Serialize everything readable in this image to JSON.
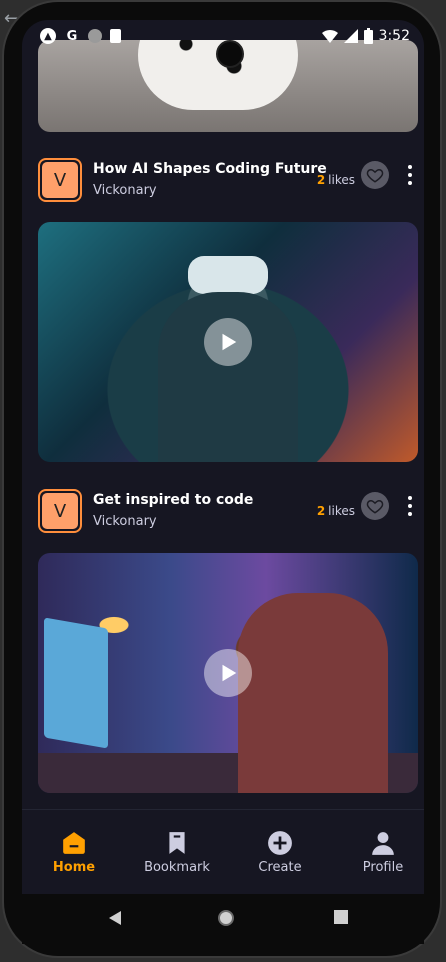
{
  "status_bar": {
    "time": "3:52"
  },
  "posts": [
    {
      "title": "How AI Shapes Coding Future",
      "creator": "Vickonary",
      "avatar_letter": "V",
      "likes_count": "2",
      "likes_label": "likes"
    },
    {
      "title": "Get inspired to code",
      "creator": "Vickonary",
      "avatar_letter": "V",
      "likes_count": "2",
      "likes_label": "likes"
    }
  ],
  "nav": {
    "items": [
      {
        "label": "Home",
        "icon": "home-icon",
        "active": true
      },
      {
        "label": "Bookmark",
        "icon": "bookmark-icon",
        "active": false
      },
      {
        "label": "Create",
        "icon": "plus-circle-icon",
        "active": false
      },
      {
        "label": "Profile",
        "icon": "profile-icon",
        "active": false
      }
    ]
  },
  "colors": {
    "accent": "#FFA001",
    "background": "#161622",
    "avatar": "#FFA06A"
  }
}
